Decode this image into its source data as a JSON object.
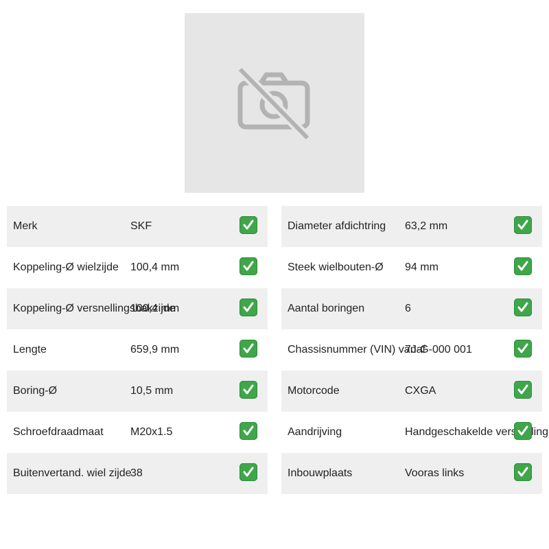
{
  "product": {
    "image_icon": "no-photo-icon"
  },
  "specs_left": [
    {
      "label": "Merk",
      "value": "SKF"
    },
    {
      "label": "Koppeling-Ø wielzijde",
      "value": "100,4 mm"
    },
    {
      "label": "Koppeling-Ø versnellingsbakzijde",
      "value": "100,4 mm"
    },
    {
      "label": "Lengte",
      "value": "659,9 mm"
    },
    {
      "label": "Boring-Ø",
      "value": "10,5 mm"
    },
    {
      "label": "Schroefdraadmaat",
      "value": "M20x1.5"
    },
    {
      "label": "Buitenvertand. wiel zijde",
      "value": "38"
    }
  ],
  "specs_right": [
    {
      "label": "Diameter afdichtring",
      "value": "63,2 mm"
    },
    {
      "label": "Steek wielbouten-Ø",
      "value": "94 mm"
    },
    {
      "label": "Aantal boringen",
      "value": "6"
    },
    {
      "label": "Chassisnummer (VIN) vanaf",
      "value": "7J-G-000 001"
    },
    {
      "label": "Motorcode",
      "value": "CXGA"
    },
    {
      "label": "Aandrijving",
      "value": "Handgeschakelde versnelling"
    },
    {
      "label": "Inbouwplaats",
      "value": "Vooras links"
    }
  ],
  "check_icon": "check-mark-button-icon",
  "colors": {
    "check_bg": "#3fa64a",
    "row_shade": "#efefef",
    "placeholder_bg": "#e6e6e6"
  }
}
